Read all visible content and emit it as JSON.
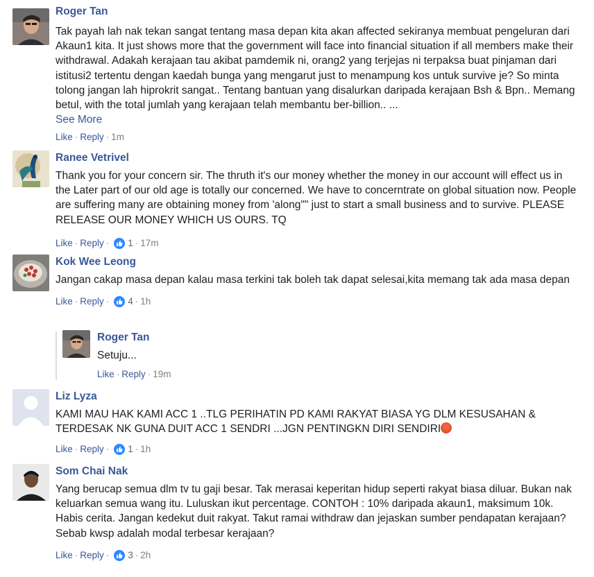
{
  "comments": [
    {
      "author": "Roger Tan",
      "text": "Tak payah lah nak tekan sangat tentang masa depan kita akan affected sekiranya membuat pengeluran dari Akaun1 kita. It just shows more that the government will face into financial situation if all members make their withdrawal. Adakah kerajaan tau akibat pamdemik ni, orang2 yang terjejas ni terpaksa buat pinjaman dari istitusi2 tertentu dengan kaedah bunga yang mengarut just to menampung kos untuk survive je? So minta tolong jangan lah hiprokrit sangat.. Tentang bantuan yang disalurkan daripada kerajaan Bsh & Bpn.. Memang betul, with the total jumlah yang kerajaan telah membantu ber-billion.. ...",
      "see_more": "See More",
      "like": "Like",
      "reply": "Reply",
      "time": "1m"
    },
    {
      "author": "Ranee Vetrivel",
      "text": "Thank you for your concern sir. The thruth it's our money whether the money in our account will effect us in the Later part of our old age is totally our concerned. We have to concerntrate on global situation now. People are suffering many are obtaining money from 'along\"\" just to start a small business and to survive. PLEASE RELEASE OUR MONEY WHICH US OURS. TQ",
      "like": "Like",
      "reply": "Reply",
      "likes": "1",
      "time": "17m"
    },
    {
      "author": "Kok Wee Leong",
      "text": "Jangan cakap masa depan kalau masa terkini tak boleh tak dapat selesai,kita memang tak ada masa depan",
      "like": "Like",
      "reply": "Reply",
      "likes": "4",
      "time": "1h"
    },
    {
      "author": "Roger Tan",
      "text": "Setuju...",
      "like": "Like",
      "reply": "Reply",
      "time": "19m"
    },
    {
      "author": "Liz Lyza",
      "text": "KAMI MAU HAK KAMI ACC 1 ..TLG PERIHATIN PD KAMI RAKYAT BIASA YG DLM KESUSAHAN & TERDESAK NK GUNA DUIT ACC 1 SENDRI ...JGN PENTINGKN DIRI SENDIRI",
      "emoji": "angry-face-emoji",
      "like": "Like",
      "reply": "Reply",
      "likes": "1",
      "time": "1h"
    },
    {
      "author": "Som Chai Nak",
      "text": "Yang berucap semua dlm tv tu gaji besar. Tak merasai keperitan hidup seperti rakyat biasa diluar. Bukan nak keluarkan semua wang itu. Luluskan ikut percentage. CONTOH : 10% daripada akaun1, maksimum 10k.\nHabis cerita. Jangan kedekut duit rakyat. Takut ramai withdraw dan jejaskan sumber pendapatan kerajaan? Sebab kwsp adalah modal terbesar kerajaan?",
      "like": "Like",
      "reply": "Reply",
      "likes": "3",
      "time": "2h"
    }
  ],
  "colors": {
    "name": "#385898",
    "text": "#1c1e21",
    "meta": "#90949c",
    "like_badge": "#2d88ff"
  },
  "icons": {
    "like_badge": "thumbs-up-icon"
  }
}
